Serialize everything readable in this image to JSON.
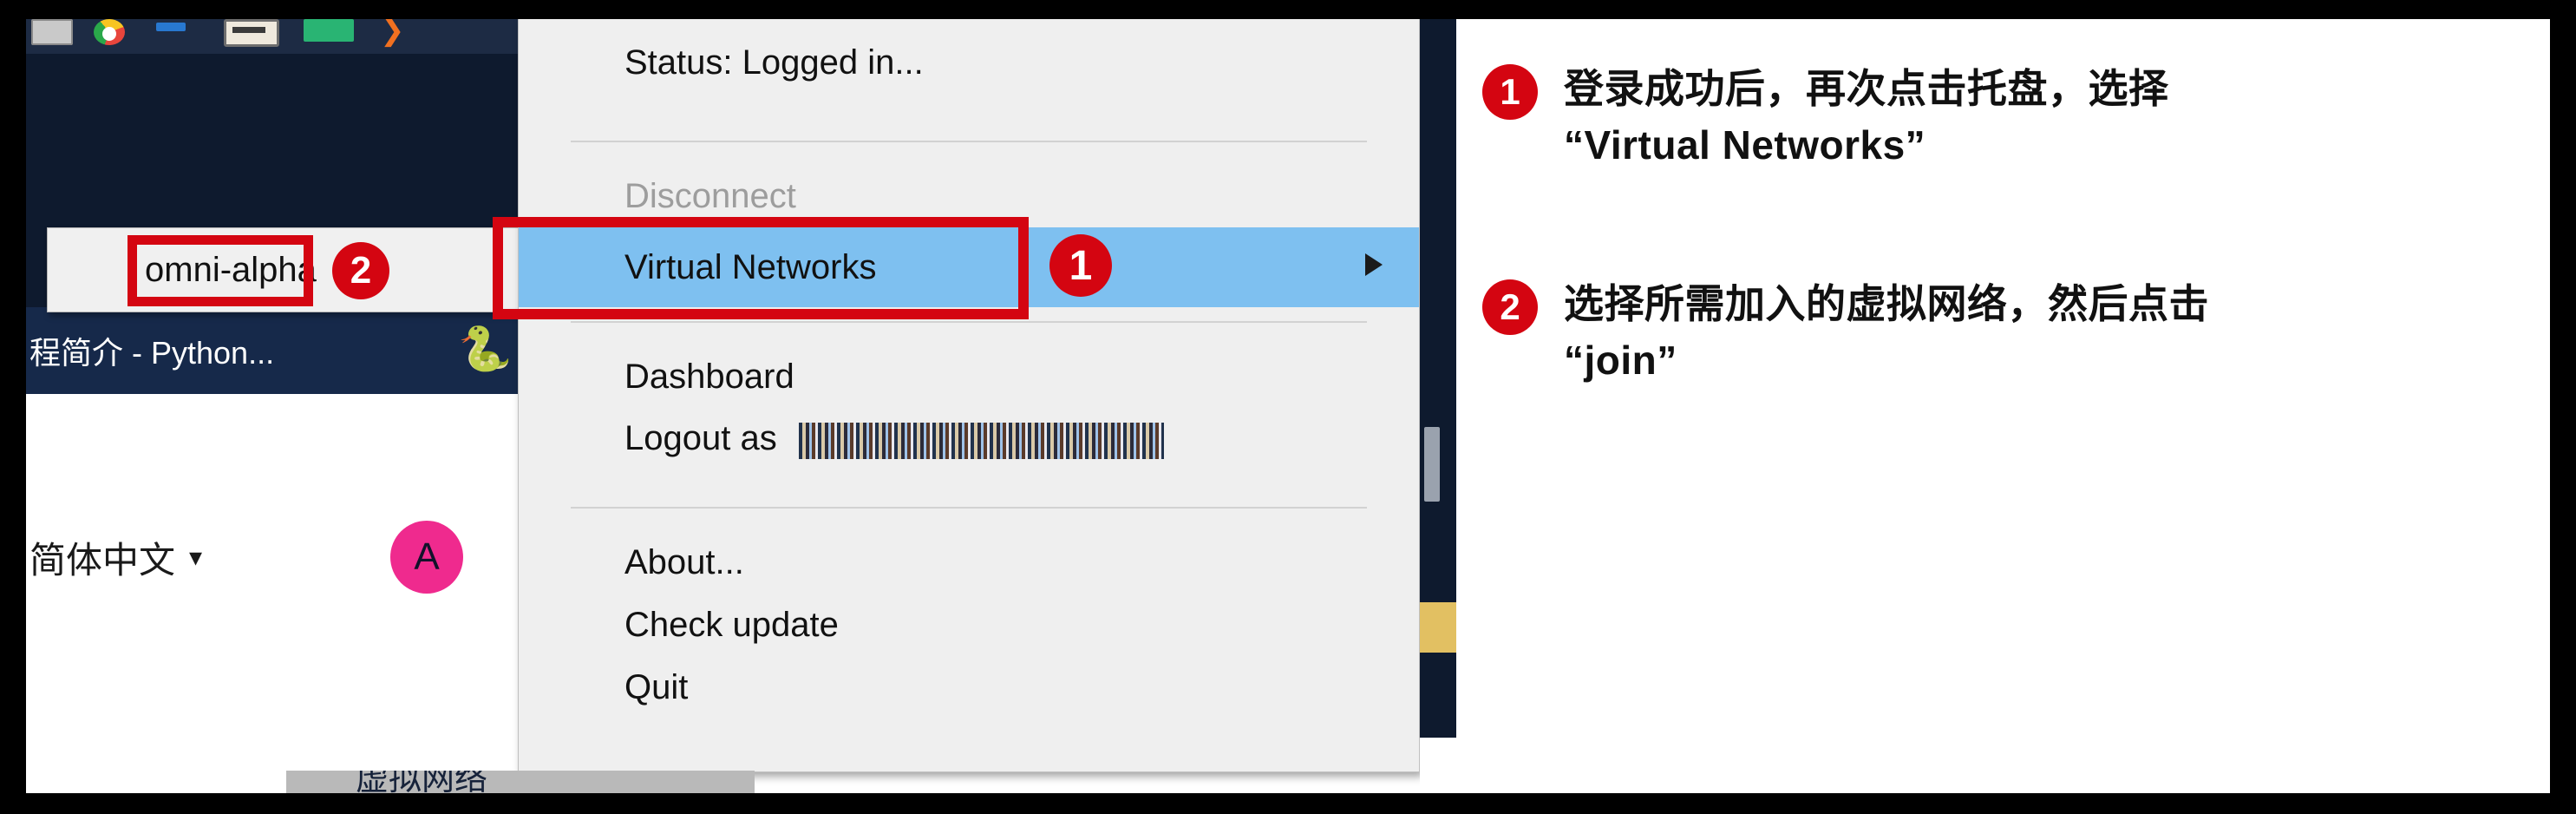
{
  "taskbar": {
    "icons": [
      {
        "name": "monitor-icon"
      },
      {
        "name": "chrome-icon"
      },
      {
        "name": "blue-app-icon"
      },
      {
        "name": "keyboard-icon"
      },
      {
        "name": "green-app-icon"
      },
      {
        "name": "orange-swoosh-icon"
      }
    ]
  },
  "background_app": {
    "window_title": "程简介 - Python...",
    "python_logo": "python-logo-icon",
    "language_selector": {
      "label": "简体中文",
      "caret": "chevron-down-icon"
    },
    "avatar_initial": "A"
  },
  "submenu": {
    "title": "omni-alpha",
    "highlight_color": "#d40511",
    "badge": "2"
  },
  "tray_menu": {
    "items": [
      {
        "id": "status",
        "label": "Status: Logged in...",
        "disabled": false,
        "highlighted": false
      },
      {
        "id": "disconnect",
        "label": "Disconnect",
        "disabled": true,
        "highlighted": false
      },
      {
        "id": "virtual",
        "label": "Virtual Networks",
        "disabled": false,
        "highlighted": true,
        "has_submenu": true,
        "badge": "1"
      },
      {
        "id": "dashboard",
        "label": "Dashboard",
        "disabled": false,
        "highlighted": false
      },
      {
        "id": "logout",
        "label": "Logout as ",
        "disabled": false,
        "highlighted": false,
        "email": "barca8best@gmail.com"
      },
      {
        "id": "about",
        "label": "About...",
        "disabled": false,
        "highlighted": false
      },
      {
        "id": "checkupdate",
        "label": "Check update",
        "disabled": false,
        "highlighted": false
      },
      {
        "id": "quit",
        "label": "Quit",
        "disabled": false,
        "highlighted": false
      }
    ],
    "highlight_bg": "#7ec0f0",
    "callout_color": "#d40511"
  },
  "bottom_clipped_text": "虚拟网络",
  "annotations": [
    {
      "badge": "1",
      "line1": "登录成功后，再次点击托盘，选择",
      "line2": "“Virtual Networks”"
    },
    {
      "badge": "2",
      "line1": "选择所需加入的虚拟网络，然后点击",
      "line2": "“join”"
    }
  ]
}
